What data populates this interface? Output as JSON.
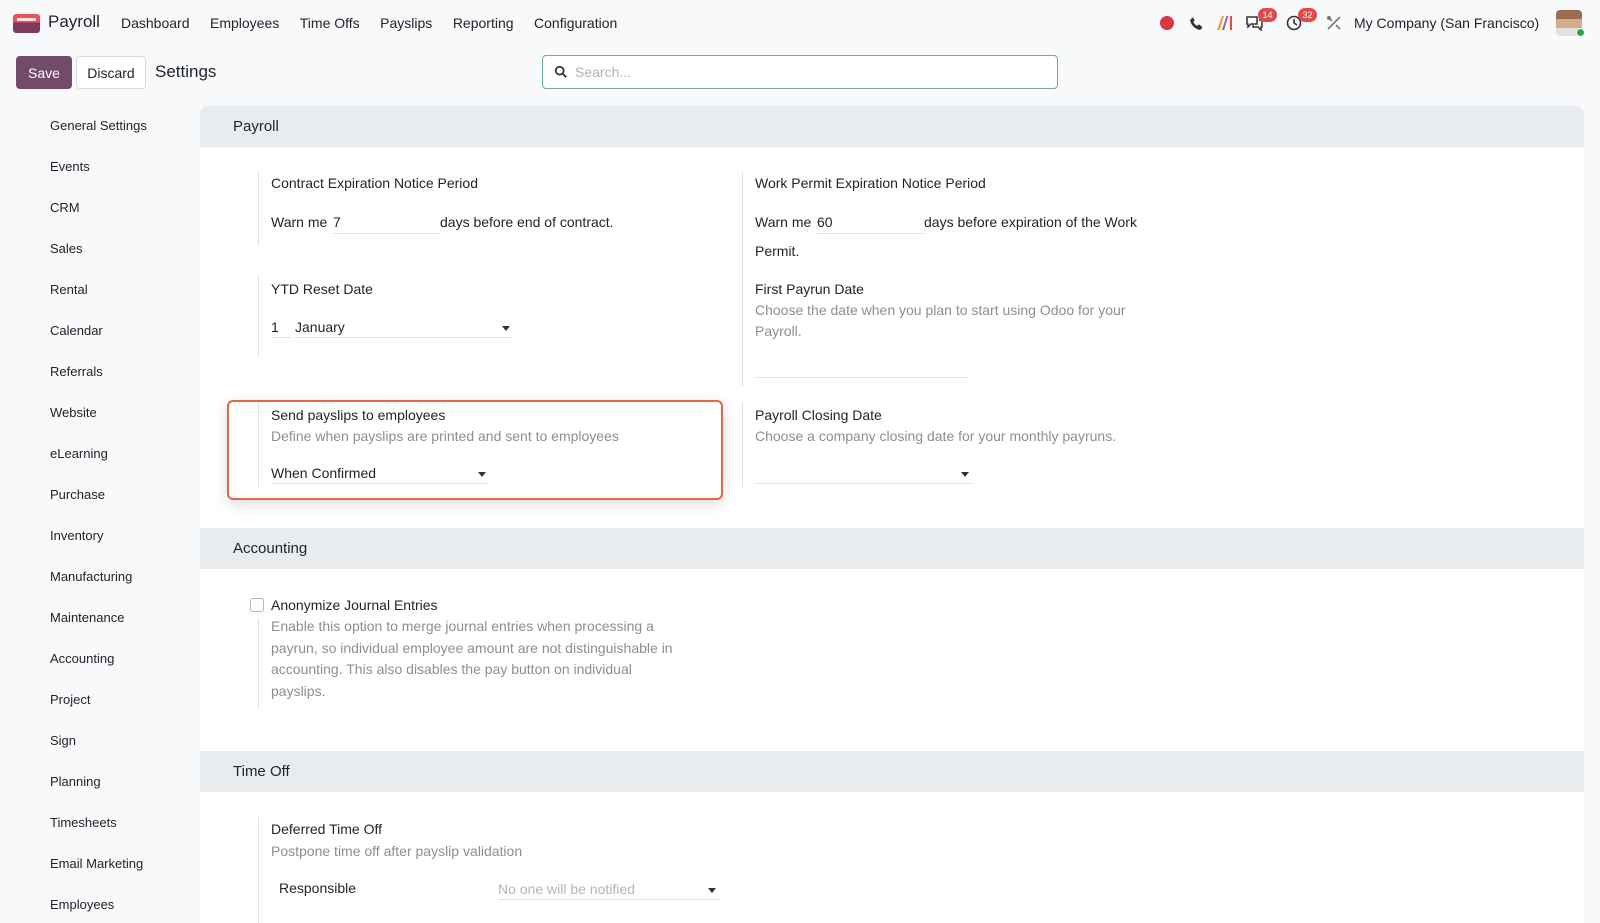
{
  "navbar": {
    "app_name": "Payroll",
    "menu": [
      "Dashboard",
      "Employees",
      "Time Offs",
      "Payslips",
      "Reporting",
      "Configuration"
    ],
    "messages_count": "14",
    "activities_count": "32",
    "company": "My Company (San Francisco)"
  },
  "control": {
    "save_label": "Save",
    "discard_label": "Discard",
    "title": "Settings",
    "search_placeholder": "Search..."
  },
  "sidebar": {
    "items": [
      "General Settings",
      "Events",
      "CRM",
      "Sales",
      "Rental",
      "Calendar",
      "Referrals",
      "Website",
      "eLearning",
      "Purchase",
      "Inventory",
      "Manufacturing",
      "Maintenance",
      "Accounting",
      "Project",
      "Sign",
      "Planning",
      "Timesheets",
      "Email Marketing",
      "Employees"
    ]
  },
  "payroll": {
    "header": "Payroll",
    "contract": {
      "title": "Contract Expiration Notice Period",
      "prefix": "Warn me",
      "value": "7",
      "suffix": "days before end of contract."
    },
    "work_permit": {
      "title": "Work Permit Expiration Notice Period",
      "prefix": "Warn me",
      "value": "60",
      "suffix": "days before expiration of the Work",
      "suffix2": "Permit."
    },
    "ytd": {
      "title": "YTD Reset Date",
      "day": "1",
      "month": "January"
    },
    "first_payrun": {
      "title": "First Payrun Date",
      "help1": "Choose the date when you plan to start using Odoo for your",
      "help2": "Payroll."
    },
    "send_payslips": {
      "title": "Send payslips to employees",
      "help": "Define when payslips are printed and sent to employees",
      "value": "When Confirmed"
    },
    "closing_date": {
      "title": "Payroll Closing Date",
      "help": "Choose a company closing date for your monthly payruns."
    }
  },
  "accounting": {
    "header": "Accounting",
    "anonymize": {
      "title": "Anonymize Journal Entries",
      "help": [
        "Enable this option to merge journal entries when processing a",
        "payrun, so individual employee amount are not distinguishable in",
        "accounting. This also disables the pay button on individual",
        "payslips."
      ],
      "checked": false
    }
  },
  "time_off": {
    "header": "Time Off",
    "deferred": {
      "title": "Deferred Time Off",
      "help": "Postpone time off after payslip validation",
      "responsible_label": "Responsible",
      "responsible_placeholder": "No one will be notified"
    }
  },
  "colors": {
    "brand": "#714b67",
    "highlight": "#e0684a",
    "badge": "#e04a4a",
    "record": "#dc3545"
  }
}
